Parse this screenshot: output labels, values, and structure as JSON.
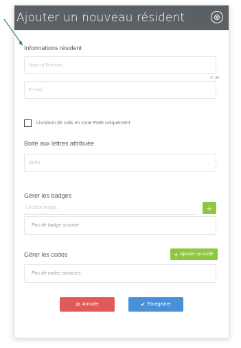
{
  "modal": {
    "title": "Ajouter un nouveau résident",
    "close_icon": "⊗"
  },
  "resident": {
    "section_title": "Informations résident",
    "name_placeholder": "Nom et Prénom",
    "counter": "0 / 30",
    "email_placeholder": "E-mail"
  },
  "pmr": {
    "checked": false,
    "label": "Livraison de colis en zone PMR uniquement"
  },
  "mailbox": {
    "section_title": "Boite aux lettres attribuée",
    "select_value": "Boîte",
    "chevron": "⌄"
  },
  "badges": {
    "section_title": "Gérer les badges",
    "input_placeholder": "Lecteur badge...",
    "add_icon": "+",
    "empty_text": "Pas de badge associé"
  },
  "codes": {
    "section_title": "Gérer les codes",
    "add_icon": "+",
    "add_label": "Ajouter un code",
    "empty_text": "Pas de codes associés"
  },
  "actions": {
    "cancel_icon": "⊘",
    "cancel_label": "Annuler",
    "save_icon": "✔",
    "save_label": "Enregistrer"
  },
  "colors": {
    "header": "#5b6065",
    "accent_green": "#8dc63f",
    "cancel_red": "#e05a5a",
    "save_blue": "#4a90d9"
  }
}
